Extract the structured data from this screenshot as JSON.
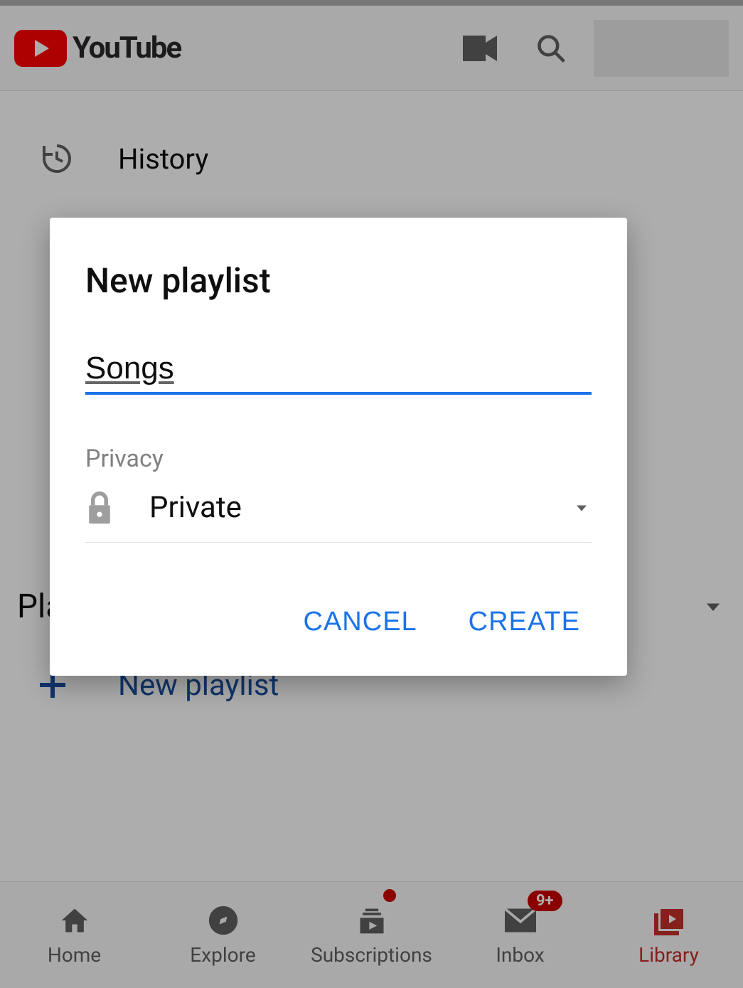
{
  "header": {
    "brand": "YouTube"
  },
  "library": {
    "history_label": "History",
    "playlists_heading": "Playlists",
    "new_playlist_label": "New playlist"
  },
  "dialog": {
    "title": "New playlist",
    "title_input_value": "Songs",
    "privacy_label": "Privacy",
    "privacy_value": "Private",
    "cancel_label": "CANCEL",
    "create_label": "CREATE"
  },
  "bottom_nav": {
    "home": "Home",
    "explore": "Explore",
    "subscriptions": "Subscriptions",
    "inbox": "Inbox",
    "inbox_badge": "9+",
    "library": "Library"
  }
}
